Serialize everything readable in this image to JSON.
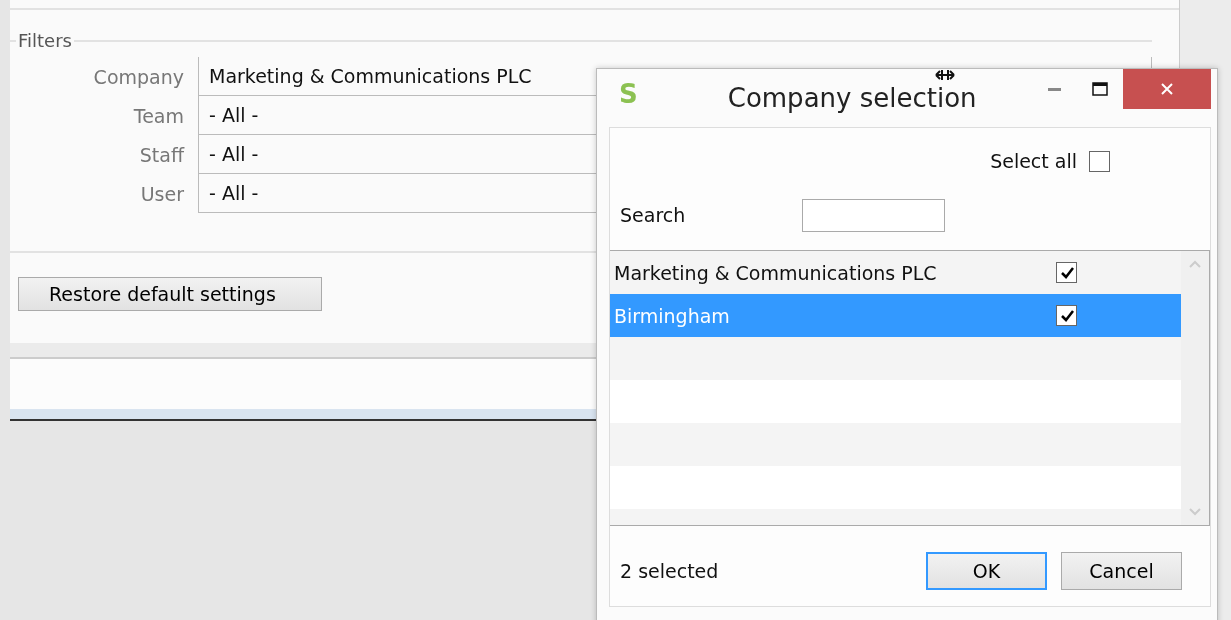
{
  "filters": {
    "legend": "Filters",
    "fields": [
      {
        "label": "Company",
        "value": "Marketing & Communications PLC"
      },
      {
        "label": "Team",
        "value": "- All -"
      },
      {
        "label": "Staff",
        "value": "- All -"
      },
      {
        "label": "User",
        "value": "- All -"
      }
    ]
  },
  "restore_button": "Restore default settings",
  "dialog": {
    "logo": "S",
    "title": "Company selection",
    "select_all": {
      "label": "Select all",
      "checked": false
    },
    "search": {
      "label": "Search"
    },
    "items": [
      {
        "name": "Marketing & Communications PLC",
        "checked": true,
        "selected": false
      },
      {
        "name": "Birmingham",
        "checked": true,
        "selected": true
      }
    ],
    "status": "2 selected",
    "buttons": [
      {
        "label": "OK",
        "default": true
      },
      {
        "label": "Cancel",
        "default": false
      }
    ]
  }
}
